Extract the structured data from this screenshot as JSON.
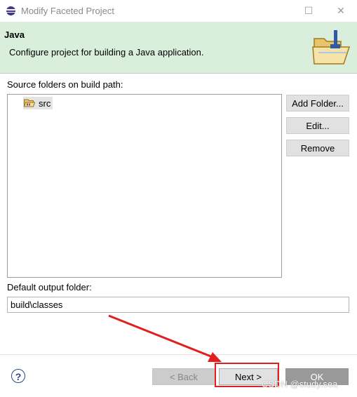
{
  "window": {
    "title": "Modify Faceted Project",
    "minimize": "☐",
    "close": "✕"
  },
  "banner": {
    "title": "Java",
    "description": "Configure project for building a Java application.",
    "icon": "java-folder-icon"
  },
  "source": {
    "label": "Source folders on build path:",
    "items": [
      {
        "label": "src",
        "icon": "source-folder-icon"
      }
    ],
    "buttons": {
      "add_folder": "Add Folder...",
      "edit": "Edit...",
      "remove": "Remove"
    }
  },
  "output": {
    "label": "Default output folder:",
    "value": "build\\classes"
  },
  "footer": {
    "help": "?",
    "back": "< Back",
    "next": "Next >",
    "ok": "OK"
  },
  "watermark": "CSDN @study.sea",
  "colors": {
    "banner_bg": "#d9eedb",
    "annotation_red": "#e02020"
  }
}
